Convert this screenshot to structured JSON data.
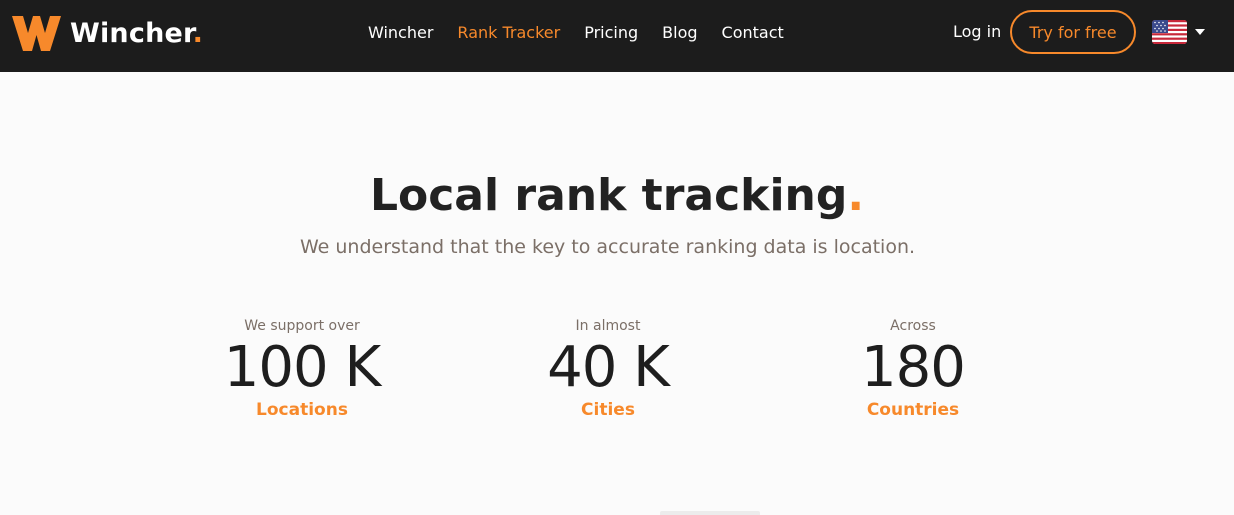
{
  "brand": {
    "name": "Wincher",
    "dot": ".",
    "accent": "#f7892b",
    "dark": "#1c1c1c"
  },
  "nav": {
    "links": [
      {
        "label": "Wincher",
        "active": false
      },
      {
        "label": "Rank Tracker",
        "active": true
      },
      {
        "label": "Pricing",
        "active": false
      },
      {
        "label": "Blog",
        "active": false
      },
      {
        "label": "Contact",
        "active": false
      }
    ],
    "login": "Log in",
    "cta": "Try for free",
    "language_icon": "us-flag-icon"
  },
  "hero": {
    "title": "Local rank tracking",
    "title_dot": ".",
    "subtitle": "We understand that the key to accurate ranking data is location."
  },
  "stats": [
    {
      "label": "We support over",
      "value": "100 K",
      "unit": "Locations"
    },
    {
      "label": "In almost",
      "value": "40 K",
      "unit": "Cities"
    },
    {
      "label": "Across",
      "value": "180",
      "unit": "Countries"
    }
  ]
}
